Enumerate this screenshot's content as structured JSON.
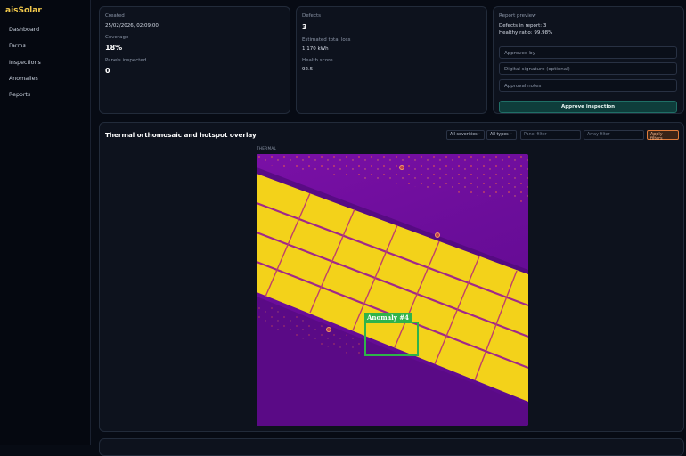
{
  "brand": "aisSolar",
  "sidebar": {
    "items": [
      {
        "label": "Dashboard"
      },
      {
        "label": "Farms"
      },
      {
        "label": "Inspections"
      },
      {
        "label": "Anomalies"
      },
      {
        "label": "Reports"
      }
    ]
  },
  "info_card": {
    "created_label": "Created",
    "created_value": "25/02/2026, 02:09:00",
    "coverage_label": "Coverage",
    "coverage_value": "18%",
    "panels_label": "Panels inspected",
    "panels_value": "0"
  },
  "defects_card": {
    "defects_label": "Defects",
    "defects_value": "3",
    "loss_label": "Estimated total loss",
    "loss_value": "1,170 kWh",
    "health_label": "Health score",
    "health_value": "92.5"
  },
  "report_card": {
    "title": "Report preview",
    "defects_line": "Defects in report: 3",
    "healthy_line": "Healthy ratio: 99.98%",
    "approved_by_placeholder": "Approved by",
    "signature_placeholder": "Digital signature (optional)",
    "notes_placeholder": "Approval notes",
    "approve_label": "Approve inspection"
  },
  "overlay": {
    "title": "Thermal orthomosaic and hotspot overlay",
    "severity_select": "All severities",
    "type_select": "All types",
    "panel_filter_placeholder": "Panel filter",
    "array_filter_placeholder": "Array filter",
    "apply_label": "Apply filters",
    "thermal_label": "THERMAL",
    "anomaly_tag": "Anomaly #4"
  },
  "colors": {
    "brand": "#f2c94c",
    "accent": "#1f6f66",
    "apply": "#e07b3a",
    "anomaly": "#2fb34a",
    "panel": "#f3d21a",
    "thermal_bg": "#6b0d9a"
  }
}
